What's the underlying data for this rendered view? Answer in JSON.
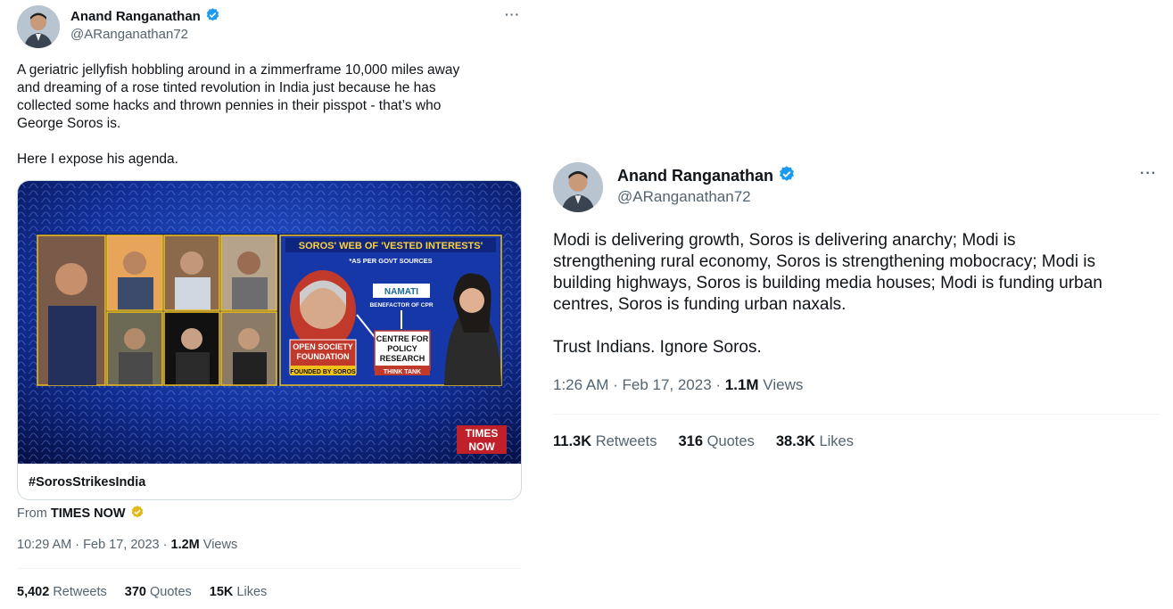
{
  "colors": {
    "verified_blue": "#1d9bf0",
    "verified_gold": "#e2b719",
    "text": "#0f1419",
    "muted": "#536471",
    "border": "#cfd9de"
  },
  "icons": {
    "verified": "verified-badge-icon",
    "more": "more-options-icon"
  },
  "left_tweet": {
    "author_name": "Anand Ranganathan",
    "handle": "@ARanganathan72",
    "more": "···",
    "text": "A geriatric jellyfish hobbling around in a zimmerframe 10,000 miles away\nand dreaming of a rose tinted revolution in India just because he has\ncollected some hacks and thrown pennies in their pisspot - that’s who\nGeorge Soros is.\n\nHere I expose his agenda.",
    "card": {
      "hashtag": "#SorosStrikesIndia",
      "video": {
        "headline": "SOROS' WEB OF 'VESTED INTERESTS'",
        "subhead": "*AS PER GOVT SOURCES",
        "box1_line1": "OPEN SOCIETY",
        "box1_line2": "FOUNDATION",
        "box1_caption": "FOUNDED BY SOROS",
        "namati": "NAMATI",
        "namati_caption": "BENEFACTOR OF CPR",
        "box2_line1": "CENTRE FOR",
        "box2_line2": "POLICY",
        "box2_line3": "RESEARCH",
        "box2_caption": "THINK TANK",
        "logo_line1": "TIMES",
        "logo_line2": "NOW"
      }
    },
    "from_label": "From",
    "from_source": "TIMES NOW",
    "time": "10:29 AM · Feb 17, 2023 · ",
    "views_count": "1.2M",
    "views_label": " Views",
    "stats": [
      {
        "count": "5,402",
        "label": " Retweets"
      },
      {
        "count": "370",
        "label": " Quotes"
      },
      {
        "count": "15K",
        "label": " Likes"
      }
    ]
  },
  "right_tweet": {
    "author_name": "Anand Ranganathan",
    "handle": "@ARanganathan72",
    "more": "···",
    "text": "Modi is delivering growth, Soros is delivering anarchy; Modi is\nstrengthening rural economy, Soros is strengthening mobocracy; Modi is\nbuilding highways, Soros is building media houses; Modi is funding urban\ncentres, Soros is funding urban naxals.\n\nTrust Indians. Ignore Soros.",
    "time": "1:26 AM · Feb 17, 2023 · ",
    "views_count": "1.1M",
    "views_label": " Views",
    "stats": [
      {
        "count": "11.3K",
        "label": " Retweets"
      },
      {
        "count": "316",
        "label": " Quotes"
      },
      {
        "count": "38.3K",
        "label": " Likes"
      }
    ]
  }
}
